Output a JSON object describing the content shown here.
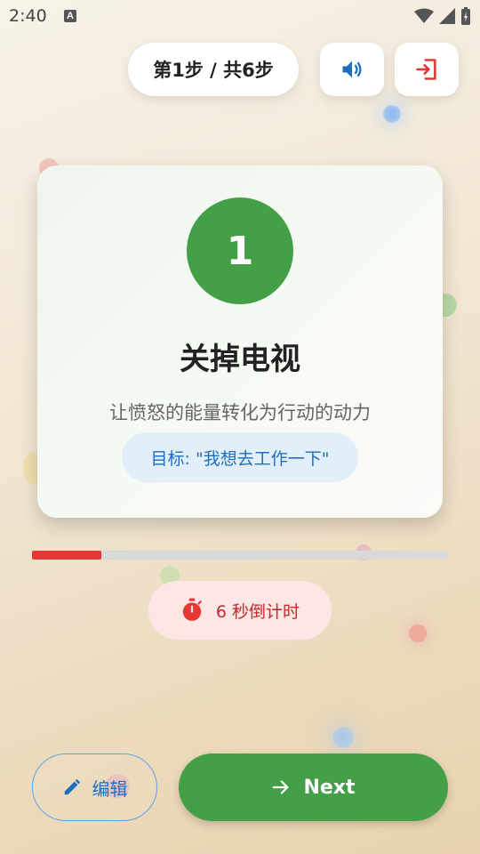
{
  "status_bar": {
    "time": "2:40",
    "notification_icon": "A"
  },
  "header": {
    "step_indicator": "第1步 / 共6步",
    "sound_icon": "volume-icon",
    "exit_icon": "exit-icon"
  },
  "card": {
    "step_number": "1",
    "title": "关掉电视",
    "description": "让愤怒的能量转化为行动的动力",
    "goal": "目标: \"我想去工作一下\""
  },
  "progress": {
    "fraction": 0.1667,
    "fill_color": "#e53935"
  },
  "timer": {
    "label": "6 秒倒计时",
    "icon": "stopwatch-icon"
  },
  "actions": {
    "edit_label": "编辑",
    "next_label": "Next"
  },
  "colors": {
    "primary_green": "#43a047",
    "accent_red": "#e53935",
    "accent_blue": "#1e6fc0"
  }
}
